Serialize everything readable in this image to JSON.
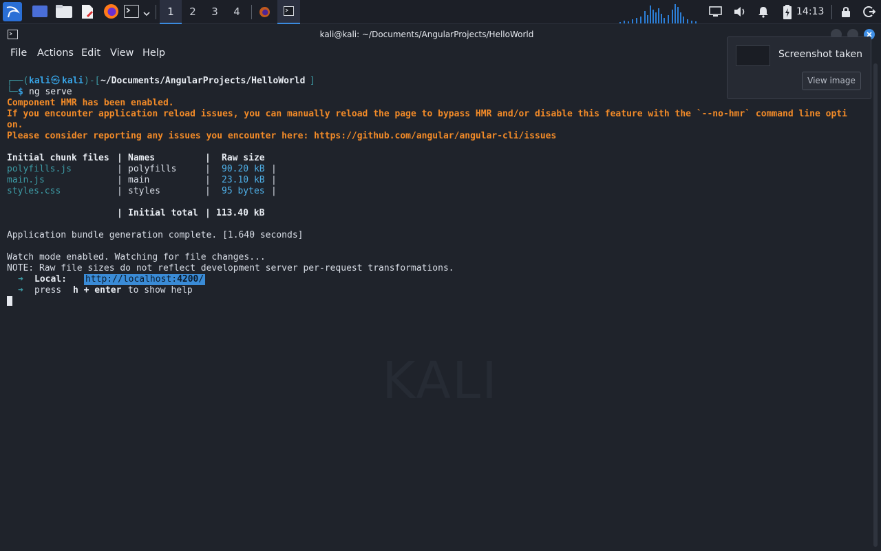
{
  "panel": {
    "workspaces": [
      "1",
      "2",
      "3",
      "4"
    ],
    "active_workspace": "1",
    "clock": "14:13",
    "icons": [
      "kali-menu-icon",
      "desktop-icon",
      "file-manager-icon",
      "text-editor-icon",
      "firefox-icon",
      "terminal-icon",
      "chevron-down-icon",
      "firefox-window-icon",
      "terminal-window-icon",
      "cpu-graph-icon",
      "display-icon",
      "volume-icon",
      "bell-icon",
      "battery-charging-icon",
      "lock-icon",
      "logout-icon"
    ]
  },
  "window": {
    "title": "kali@kali: ~/Documents/AngularProjects/HelloWorld",
    "menu": [
      "File",
      "Actions",
      "Edit",
      "View",
      "Help"
    ]
  },
  "terminal": {
    "prompt_user": "kali",
    "prompt_at": "㉿",
    "prompt_host": "kali",
    "prompt_path": "~/Documents/AngularProjects/HelloWorld",
    "command": "ng serve",
    "warning_1": "Component HMR has been enabled.",
    "warning_2": "If you encounter application reload issues, you can manually reload the page to bypass HMR and/or disable this feature with the `--no-hmr` command line opti",
    "warning_2_wrap": "on.",
    "warning_3": "Please consider reporting any issues you encounter here: https://github.com/angular/angular-cli/issues",
    "table_header": {
      "files": "Initial chunk files",
      "names": "Names",
      "size": "Raw size"
    },
    "rows": [
      {
        "file": "polyfills.js",
        "name": "polyfills",
        "size": "90.20 kB"
      },
      {
        "file": "main.js",
        "name": "main",
        "size": "23.10 kB"
      },
      {
        "file": "styles.css",
        "name": "styles",
        "size": "95 bytes"
      }
    ],
    "total_label": "Initial total",
    "total_value": "113.40 kB",
    "bundle_msg": "Application bundle generation complete. [1.640 seconds]",
    "watch_msg": "Watch mode enabled. Watching for file changes...",
    "note_msg": "NOTE: Raw file sizes do not reflect development server per-request transformations.",
    "local_arrow": "➜",
    "local_label": "Local:",
    "local_url_pre": "http://localhost:",
    "local_url_port": "4200",
    "local_url_post": "/",
    "help_pre": "press ",
    "help_key": "h + enter",
    "help_post": " to show help"
  },
  "notification": {
    "title": "Screenshot taken",
    "button": "View image"
  },
  "desktop": {
    "watermark": "KALI"
  }
}
